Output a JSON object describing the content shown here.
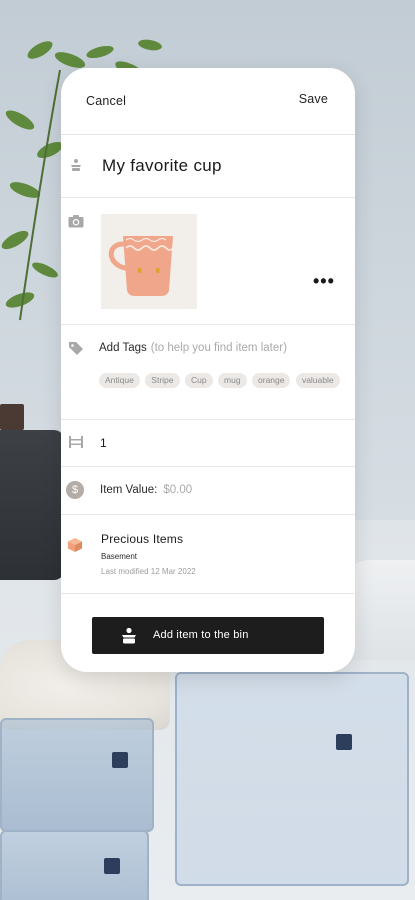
{
  "header": {
    "cancel_label": "Cancel",
    "save_label": "Save"
  },
  "item": {
    "name": "My favorite cup",
    "more_label": "•••"
  },
  "tags": {
    "label": "Add Tags",
    "hint": "(to help you find item later)",
    "chips": [
      "Antique",
      "Stripe",
      "Cup",
      "mug",
      "orange",
      "valuable"
    ]
  },
  "quantity": {
    "value": "1"
  },
  "value": {
    "label": "Item Value:",
    "amount": "$0.00",
    "coin_symbol": "$"
  },
  "bin": {
    "name": "Precious Items",
    "location": "Basement",
    "last_modified": "Last modified 12 Mar 2022"
  },
  "actions": {
    "add_to_bin_label": "Add item to the bin"
  },
  "colors": {
    "accent_box": "#f0a07a",
    "cup": "#f0a68a",
    "button_bg": "#1d1d1d"
  }
}
